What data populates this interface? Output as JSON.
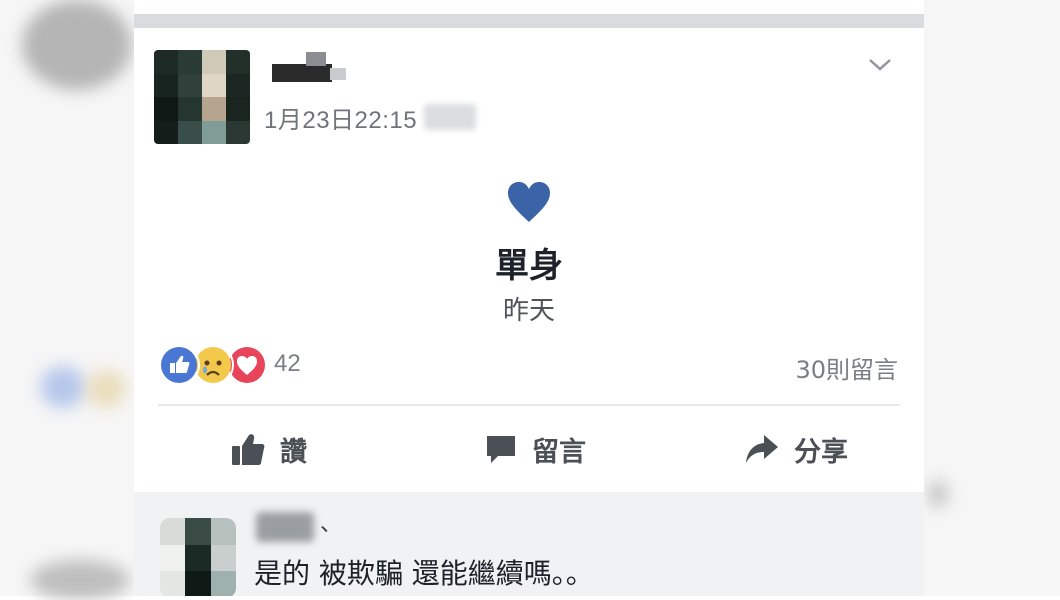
{
  "post": {
    "timestamp": "1月23日22:15",
    "life_event": {
      "icon": "heart-icon",
      "title": "單身",
      "subtitle": "昨天"
    },
    "reactions": {
      "icons": [
        "like-icon",
        "sad-icon",
        "love-icon"
      ],
      "count": "42",
      "comment_count": "30則留言"
    },
    "actions": {
      "like_label": "讚",
      "comment_label": "留言",
      "share_label": "分享"
    }
  },
  "comment": {
    "name_suffix": "、",
    "text": "是的 被欺騙 還能繼續嗎。。"
  },
  "colors": {
    "heart": "#3b63a8",
    "like_blue": "#4a76d4",
    "love_red": "#e8455b",
    "sad_yellow": "#f3c94b",
    "text_gray": "#6f747a"
  }
}
